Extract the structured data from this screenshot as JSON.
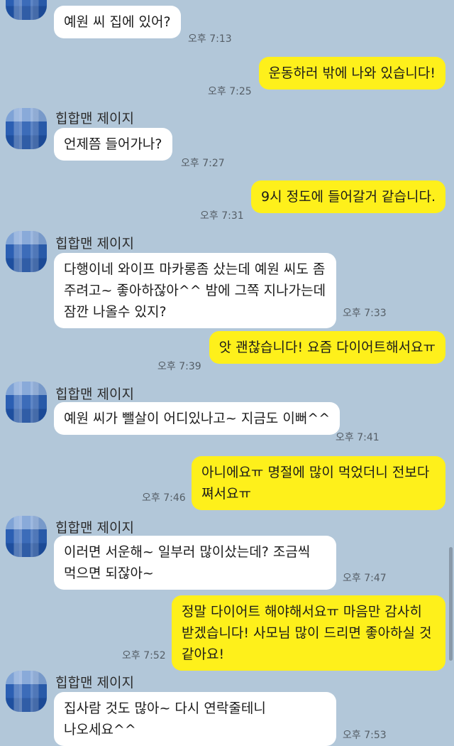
{
  "chat": {
    "sender_name": "힙합맨 제이지",
    "messages": [
      {
        "side": "in",
        "text": "예원 씨 집에 있어?",
        "time": "오후 7:13"
      },
      {
        "side": "out",
        "text": "운동하러 밖에 나와 있습니다!",
        "time": "오후 7:25"
      },
      {
        "side": "in",
        "text": "언제쯤 들어가나?",
        "time": "오후 7:27"
      },
      {
        "side": "out",
        "text": "9시 정도에 들어갈거 같습니다.",
        "time": "오후 7:31"
      },
      {
        "side": "in",
        "text": "다행이네 와이프 마카롱좀 샀는데 예원 씨도 좀\n주려고~ 좋아하잖아^^ 밤에 그쪽 지나가는데\n잠깐 나올수 있지?",
        "time": "오후 7:33"
      },
      {
        "side": "out",
        "text": "앗 괜찮습니다! 요즘 다이어트해서요ㅠ",
        "time": "오후 7:39"
      },
      {
        "side": "in",
        "text": "예원 씨가 뺄살이 어디있나고~ 지금도 이뻐^^",
        "time": "오후 7:41"
      },
      {
        "side": "out",
        "text": "아니에요ㅠ 명절에 많이 먹었더니 전보다\n쪄서요ㅠ",
        "time": "오후 7:46"
      },
      {
        "side": "in",
        "text": "이러면 서운해~ 일부러 많이샀는데? 조금씩\n먹으면 되잖아~",
        "time": "오후 7:47"
      },
      {
        "side": "out",
        "text": "정말 다이어트 해야해서요ㅠ 마음만 감사히\n받겠습니다! 사모님 많이 드리면 좋아하실 것\n같아요!",
        "time": "오후 7:52"
      },
      {
        "side": "in",
        "text": "집사람 것도 많아~ 다시 연락줄테니\n나오세요^^",
        "time": "오후 7:53"
      }
    ]
  },
  "colors": {
    "background": "#b2c7d9",
    "incoming_bubble": "#ffffff",
    "outgoing_bubble": "#fef01b",
    "timestamp": "#555e66"
  }
}
